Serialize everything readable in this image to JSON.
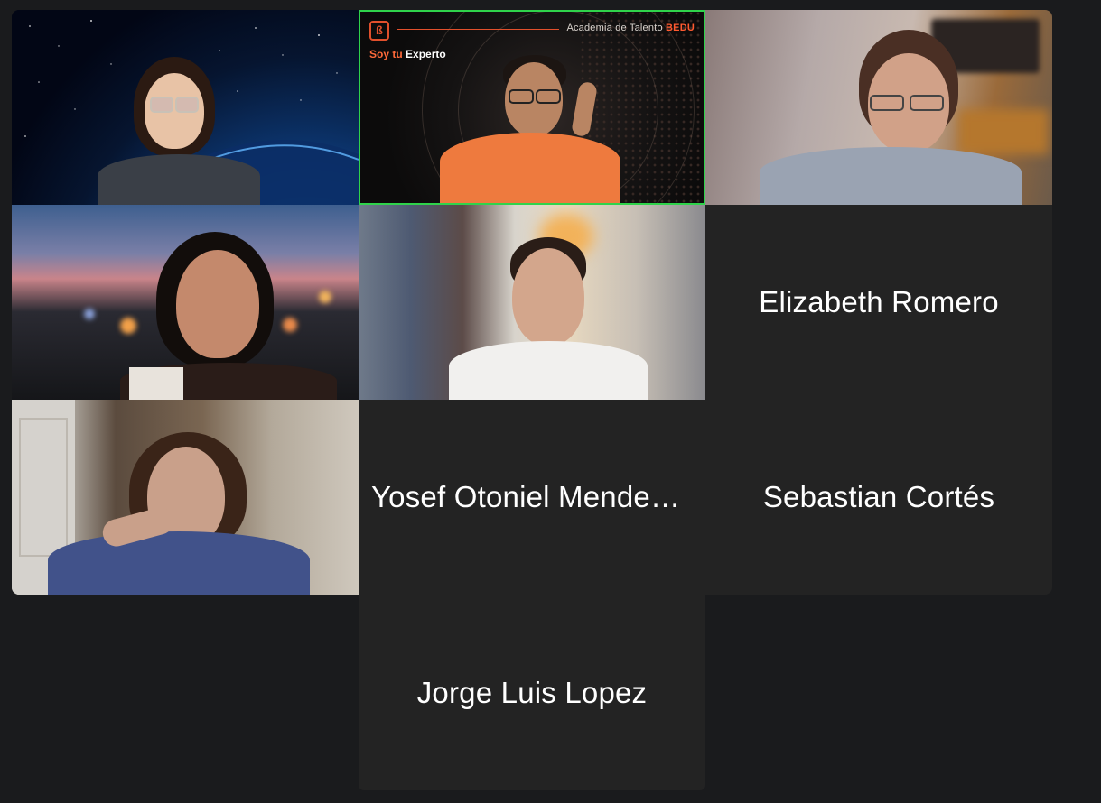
{
  "meeting": {
    "participants": [
      {
        "id": 1,
        "type": "video",
        "description_name": "participant-video-1"
      },
      {
        "id": 2,
        "type": "video",
        "active_speaker": true
      },
      {
        "id": 3,
        "type": "video"
      },
      {
        "id": 4,
        "type": "video"
      },
      {
        "id": 5,
        "type": "video"
      },
      {
        "id": 6,
        "type": "name",
        "name": "Elizabeth Romero"
      },
      {
        "id": 7,
        "type": "video"
      },
      {
        "id": 8,
        "type": "name",
        "name": "Yosef Otoniel Mendez…"
      },
      {
        "id": 9,
        "type": "name",
        "name": "Sebastian Cortés"
      },
      {
        "id": 10,
        "type": "name",
        "name": "Jorge Luis Lopez"
      }
    ]
  },
  "bedu_overlay": {
    "logo": "ß",
    "brand_prefix": "Academia de Talento ",
    "brand_accent": "BEDU",
    "slogan_prefix": "Soy tu ",
    "slogan_accent": "Experto"
  },
  "colors": {
    "background": "#1a1b1d",
    "tile": "#232323",
    "active_border": "#2fd34b",
    "bedu_orange": "#e2502c"
  }
}
